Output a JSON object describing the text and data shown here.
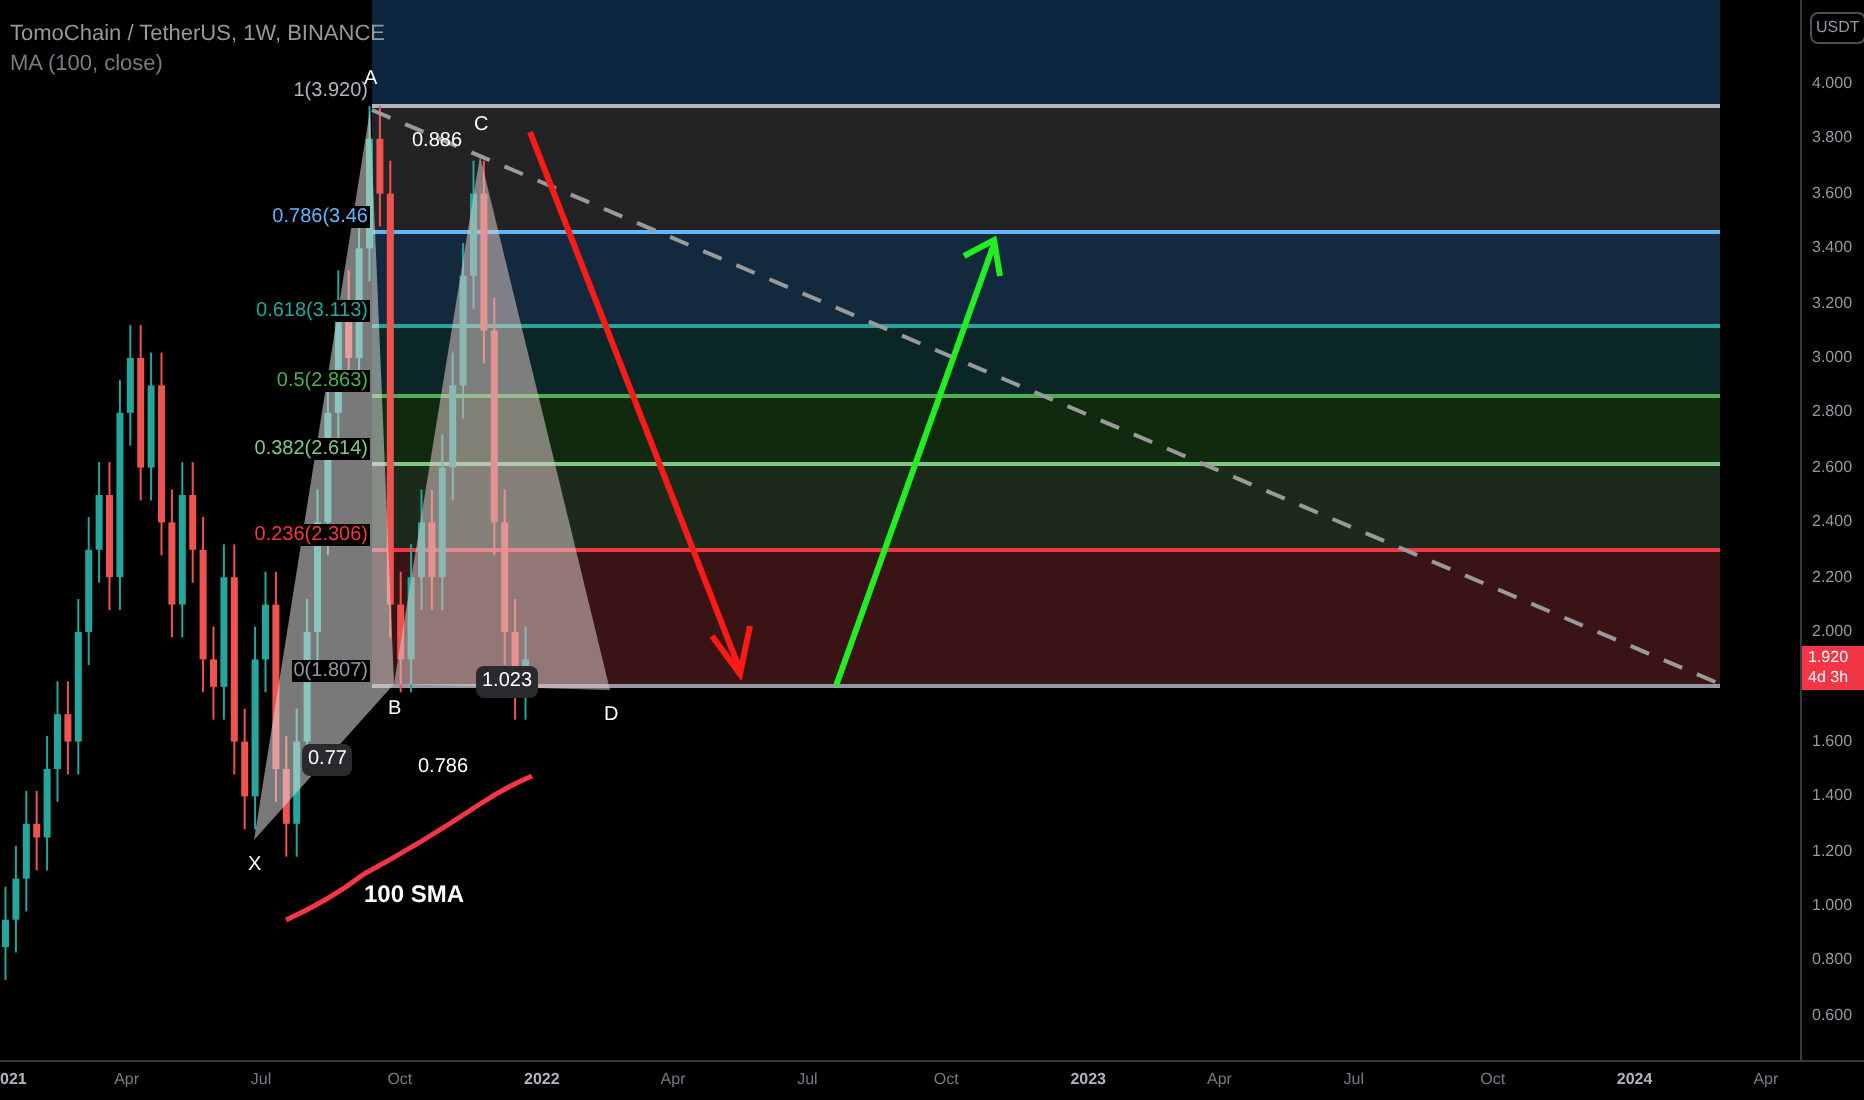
{
  "header": {
    "title": "TomoChain / TetherUS, 1W, BINANCE",
    "indicator": "MA (100, close)"
  },
  "fib_levels": [
    {
      "label": "1(3.920)",
      "color": "#b2b5be"
    },
    {
      "label": "0.786(3.46",
      "color": "#64b5f6"
    },
    {
      "label": "0.618(3.113)",
      "color": "#26a69a"
    },
    {
      "label": "0.5(2.863)",
      "color": "#4caf50"
    },
    {
      "label": "0.382(2.614)",
      "color": "#81c784"
    },
    {
      "label": "0.236(2.306)",
      "color": "#f23645"
    },
    {
      "label": "0(1.807)",
      "color": "#9598a1"
    }
  ],
  "pattern_points": [
    "X",
    "A",
    "B",
    "C",
    "D"
  ],
  "ratios": [
    {
      "label": "0.886",
      "kind": "plain"
    },
    {
      "label": "0.77",
      "kind": "boxed"
    },
    {
      "label": "0.786",
      "kind": "plain"
    },
    {
      "label": "1.023",
      "kind": "boxed"
    }
  ],
  "sma_label": "100 SMA",
  "price_axis": {
    "unit": "USDT",
    "ticks": [
      "4.000",
      "3.800",
      "3.600",
      "3.400",
      "3.200",
      "3.000",
      "2.800",
      "2.600",
      "2.400",
      "2.200",
      "2.000",
      "1.600",
      "1.400",
      "1.200",
      "1.000",
      "0.800",
      "0.600"
    ],
    "last_price": "1.920",
    "countdown": "4d 3h"
  },
  "time_axis": [
    {
      "label": "021",
      "kind": "year"
    },
    {
      "label": "Apr",
      "kind": "month"
    },
    {
      "label": "Jul",
      "kind": "month"
    },
    {
      "label": "Oct",
      "kind": "month"
    },
    {
      "label": "2022",
      "kind": "year"
    },
    {
      "label": "Apr",
      "kind": "month"
    },
    {
      "label": "Jul",
      "kind": "month"
    },
    {
      "label": "Oct",
      "kind": "month"
    },
    {
      "label": "2023",
      "kind": "year"
    },
    {
      "label": "Apr",
      "kind": "month"
    },
    {
      "label": "Jul",
      "kind": "month"
    },
    {
      "label": "Oct",
      "kind": "month"
    },
    {
      "label": "2024",
      "kind": "year"
    },
    {
      "label": "Apr",
      "kind": "month"
    }
  ]
}
